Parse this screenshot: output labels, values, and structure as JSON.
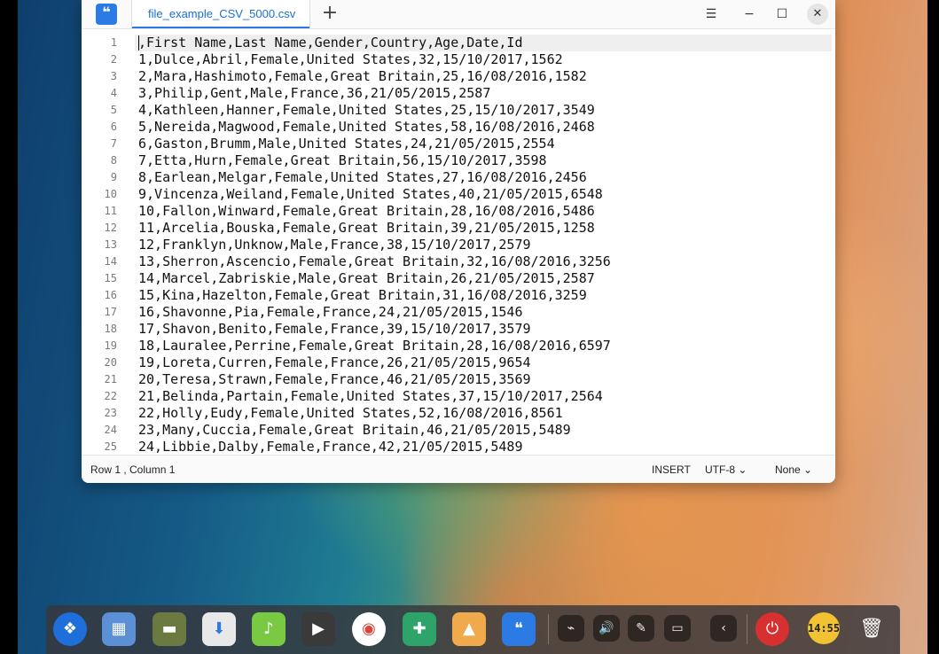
{
  "window": {
    "tab_title": "file_example_CSV_5000.csv",
    "new_tab_icon": "plus-icon",
    "controls": {
      "menu_icon": "☰",
      "minimize_icon": "−",
      "maximize_icon": "☐",
      "close_icon": "✕"
    }
  },
  "editor": {
    "line_numbers": [
      "1",
      "2",
      "3",
      "4",
      "5",
      "6",
      "7",
      "8",
      "9",
      "10",
      "11",
      "12",
      "13",
      "14",
      "15",
      "16",
      "17",
      "18",
      "19",
      "20",
      "21",
      "22",
      "23",
      "24",
      "25"
    ],
    "lines": [
      ",First Name,Last Name,Gender,Country,Age,Date,Id",
      "1,Dulce,Abril,Female,United States,32,15/10/2017,1562",
      "2,Mara,Hashimoto,Female,Great Britain,25,16/08/2016,1582",
      "3,Philip,Gent,Male,France,36,21/05/2015,2587",
      "4,Kathleen,Hanner,Female,United States,25,15/10/2017,3549",
      "5,Nereida,Magwood,Female,United States,58,16/08/2016,2468",
      "6,Gaston,Brumm,Male,United States,24,21/05/2015,2554",
      "7,Etta,Hurn,Female,Great Britain,56,15/10/2017,3598",
      "8,Earlean,Melgar,Female,United States,27,16/08/2016,2456",
      "9,Vincenza,Weiland,Female,United States,40,21/05/2015,6548",
      "10,Fallon,Winward,Female,Great Britain,28,16/08/2016,5486",
      "11,Arcelia,Bouska,Female,Great Britain,39,21/05/2015,1258",
      "12,Franklyn,Unknow,Male,France,38,15/10/2017,2579",
      "13,Sherron,Ascencio,Female,Great Britain,32,16/08/2016,3256",
      "14,Marcel,Zabriskie,Male,Great Britain,26,21/05/2015,2587",
      "15,Kina,Hazelton,Female,Great Britain,31,16/08/2016,3259",
      "16,Shavonne,Pia,Female,France,24,21/05/2015,1546",
      "17,Shavon,Benito,Female,France,39,15/10/2017,3579",
      "18,Lauralee,Perrine,Female,Great Britain,28,16/08/2016,6597",
      "19,Loreta,Curren,Female,France,26,21/05/2015,9654",
      "20,Teresa,Strawn,Female,France,46,21/05/2015,3569",
      "21,Belinda,Partain,Female,United States,37,15/10/2017,2564",
      "22,Holly,Eudy,Female,United States,52,16/08/2016,8561",
      "23,Many,Cuccia,Female,Great Britain,46,21/05/2015,5489",
      "24,Libbie,Dalby,Female,France,42,21/05/2015,5489"
    ]
  },
  "statusbar": {
    "position": "Row 1 , Column 1",
    "mode": "INSERT",
    "encoding": "UTF-8 ⌄",
    "syntax": "None ⌄"
  },
  "dock": {
    "apps": [
      "launcher-icon",
      "multitask-view-icon",
      "file-manager-icon",
      "app-store-icon",
      "music-icon",
      "video-icon",
      "chrome-icon",
      "settings-icon",
      "image-viewer-icon",
      "text-editor-icon"
    ],
    "tray": [
      "usb-icon",
      "volume-icon",
      "pen-icon",
      "battery-icon",
      "chevron-left-icon"
    ],
    "clock": "14:55",
    "power_icon": "power-icon",
    "trash_icon": "trash-icon"
  }
}
